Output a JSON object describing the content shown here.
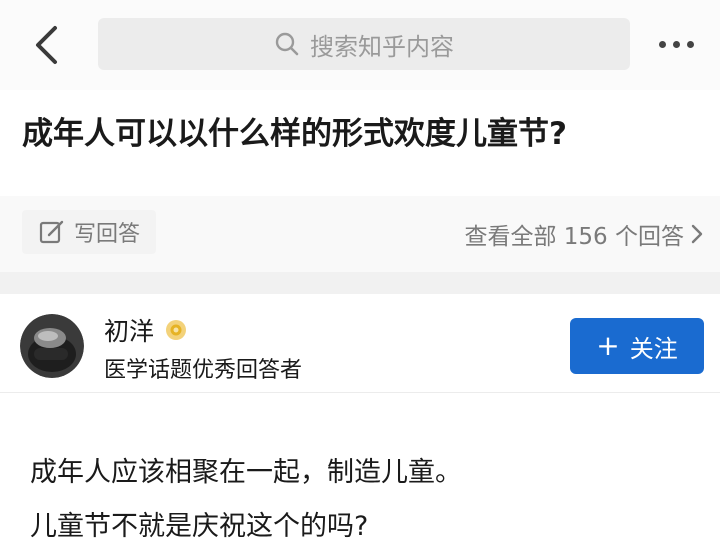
{
  "search": {
    "placeholder": "搜索知乎内容"
  },
  "icons": {
    "back": "chevron-left-icon",
    "search": "search-icon",
    "more": "more-dots-icon",
    "write": "pencil-icon",
    "arrow": "chevron-right-icon",
    "badge": "gold-badge-icon"
  },
  "question": {
    "title": "成年人可以以什么样的形式欢度儿童节?"
  },
  "actions": {
    "write_answer": "写回答",
    "view_all": "查看全部 156 个回答",
    "answer_count": 156
  },
  "author": {
    "name": "初洋",
    "description": "医学话题优秀回答者",
    "follow_label": "关注",
    "follow_plus": "+"
  },
  "answer": {
    "lines": [
      "成年人应该相聚在一起，制造儿童。",
      "儿童节不就是庆祝这个的吗?"
    ]
  },
  "colors": {
    "accent": "#1a6bd0",
    "badge": "#e6b325",
    "text_primary": "#1a1a1a",
    "text_secondary": "#7a7a7a"
  }
}
